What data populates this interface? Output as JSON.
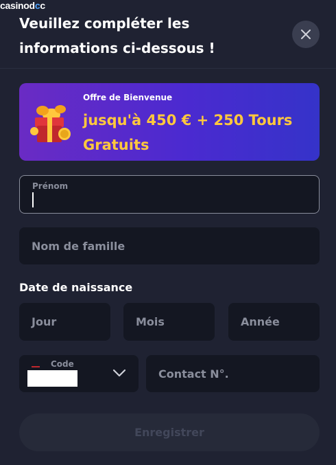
{
  "watermark": {
    "text_a": "casinod",
    "text_b": "c",
    "text_c": "c"
  },
  "modal": {
    "title": "Veuillez compléter les informations ci-dessous !",
    "close_icon": "close-icon"
  },
  "banner": {
    "kicker": "Offre de Bienvenue",
    "offer": "jusqu'à 450 € + 250 Tours Gratuits",
    "icon": "gift-icon",
    "colors": {
      "gradient_start": "#6a2bc4",
      "gradient_end": "#3533c9",
      "offer_text": "#ffc83d"
    }
  },
  "form": {
    "first_name": {
      "label": "Prénom",
      "value": ""
    },
    "last_name": {
      "placeholder": "Nom de famille",
      "value": ""
    },
    "birth_date": {
      "label": "Date de naissance",
      "day": {
        "placeholder": "Jour"
      },
      "month": {
        "placeholder": "Mois"
      },
      "year": {
        "placeholder": "Année"
      }
    },
    "phone": {
      "code_label": "Code",
      "code_icon": "chevron-down-icon",
      "contact_placeholder": "Contact N°."
    },
    "submit_label": "Enregistrer"
  },
  "colors": {
    "background": "#1f2232",
    "field_background": "#141722",
    "placeholder_text": "#8a8e9c",
    "disabled_button": "#262a39"
  }
}
